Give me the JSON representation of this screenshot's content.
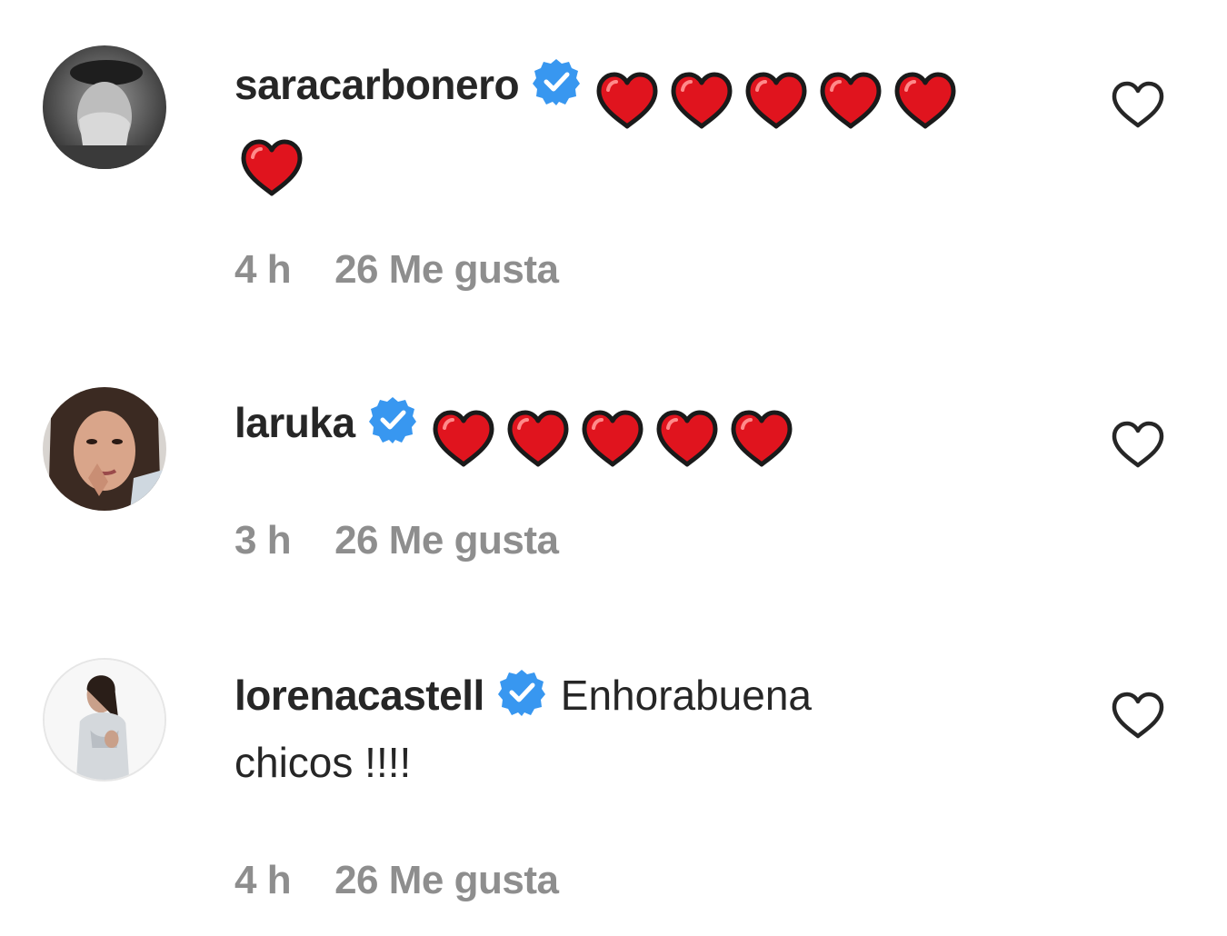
{
  "comments": [
    {
      "username": "saracarbonero",
      "verified": true,
      "text": "",
      "emoji_count": 6,
      "time": "4 h",
      "likes": "26 Me gusta"
    },
    {
      "username": "laruka",
      "verified": true,
      "text": "",
      "emoji_count": 5,
      "time": "3 h",
      "likes": "26 Me gusta"
    },
    {
      "username": "lorenacastell",
      "verified": true,
      "text_line1": "Enhorabuena",
      "text_line2": "chicos !!!!",
      "time": "4 h",
      "likes": "26 Me gusta"
    }
  ],
  "colors": {
    "verified_blue": "#3897f0",
    "heart_red": "#e0141e",
    "meta_gray": "#8e8e8e",
    "text_dark": "#262626"
  },
  "icons": {
    "verified": "verified-badge-icon",
    "like": "heart-outline-icon",
    "emoji": "red-heart-emoji"
  }
}
